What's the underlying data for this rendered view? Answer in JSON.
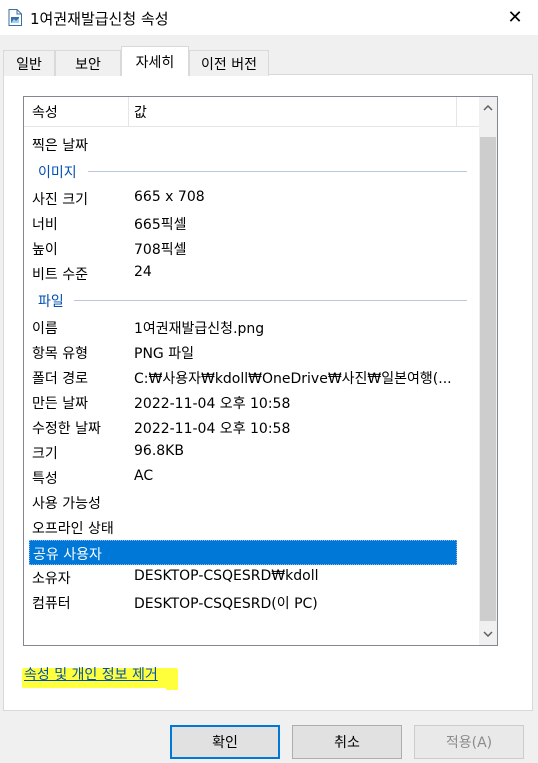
{
  "window": {
    "title": "1여권재발급신청 속성",
    "close_glyph": "✕"
  },
  "tabs": [
    {
      "label": "일반"
    },
    {
      "label": "보안"
    },
    {
      "label": "자세히"
    },
    {
      "label": "이전 버전"
    }
  ],
  "table": {
    "header_property": "속성",
    "header_value": "값",
    "rows": [
      {
        "key": "찍은 날짜",
        "value": ""
      },
      {
        "group": "이미지"
      },
      {
        "key": "사진 크기",
        "value": "665 x 708"
      },
      {
        "key": "너비",
        "value": "665픽셀"
      },
      {
        "key": "높이",
        "value": "708픽셀"
      },
      {
        "key": "비트 수준",
        "value": "24"
      },
      {
        "group": "파일"
      },
      {
        "key": "이름",
        "value": "1여권재발급신청.png"
      },
      {
        "key": "항목 유형",
        "value": "PNG 파일"
      },
      {
        "key": "폴더 경로",
        "value": "C:₩사용자₩kdoll₩OneDrive₩사진₩일본여행(..."
      },
      {
        "key": "만든 날짜",
        "value": "2022-11-04 오후 10:58"
      },
      {
        "key": "수정한 날짜",
        "value": "2022-11-04 오후 10:58"
      },
      {
        "key": "크기",
        "value": "96.8KB"
      },
      {
        "key": "특성",
        "value": "AC"
      },
      {
        "key": "사용 가능성",
        "value": ""
      },
      {
        "key": "오프라인 상태",
        "value": ""
      },
      {
        "key": "공유 사용자",
        "value": ""
      },
      {
        "key": "소유자",
        "value": "DESKTOP-CSQESRD₩kdoll"
      },
      {
        "key": "컴퓨터",
        "value": "DESKTOP-CSQESRD(이 PC)"
      }
    ]
  },
  "remove_link": "속성 및 개인 정보 제거",
  "buttons": {
    "ok": "확인",
    "cancel": "취소",
    "apply": "적용(A)"
  },
  "colors": {
    "selection": "#0078d7",
    "group_text": "#0050b4",
    "highlight": "#ffff3c"
  }
}
